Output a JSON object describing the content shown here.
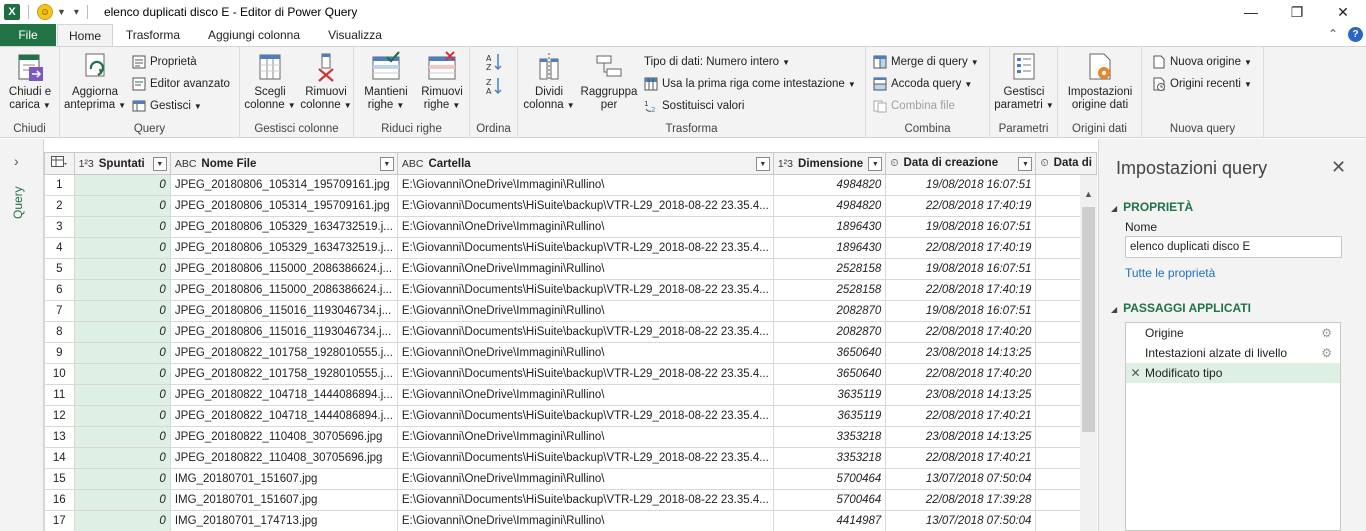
{
  "titlebar": {
    "app_badge": "X",
    "title": "elenco duplicati disco E - Editor di Power Query",
    "minimize": "—",
    "restore": "❐",
    "close": "✕"
  },
  "tabs": {
    "file": "File",
    "items": [
      "Home",
      "Trasforma",
      "Aggiungi colonna",
      "Visualizza"
    ],
    "active": "Home",
    "collapse": "⌃",
    "help": "?"
  },
  "ribbon": {
    "chiudi": {
      "label": "Chiudi",
      "btn1": "Chiudi e",
      "btn2": "carica"
    },
    "query": {
      "label": "Query",
      "refresh1": "Aggiorna",
      "refresh2": "anteprima",
      "properties": "Proprietà",
      "advanced_editor": "Editor avanzato",
      "manage": "Gestisci"
    },
    "manage_columns": {
      "label": "Gestisci colonne",
      "choose1": "Scegli",
      "choose2": "colonne",
      "remove1": "Rimuovi",
      "remove2": "colonne"
    },
    "reduce_rows": {
      "label": "Riduci righe",
      "keep1": "Mantieni",
      "keep2": "righe",
      "remove1": "Rimuovi",
      "remove2": "righe"
    },
    "sort": {
      "label": "Ordina"
    },
    "transform": {
      "label": "Trasforma",
      "split1": "Dividi",
      "split2": "colonna",
      "group1": "Raggruppa",
      "group2": "per",
      "data_type": "Tipo di dati: Numero intero",
      "first_row": "Usa la prima riga come intestazione",
      "replace": "Sostituisci valori"
    },
    "combine": {
      "label": "Combina",
      "merge": "Merge di query",
      "append": "Accoda query",
      "combine_files": "Combina file"
    },
    "params": {
      "label": "Parametri",
      "manage1": "Gestisci",
      "manage2": "parametri"
    },
    "data_sources": {
      "label": "Origini dati",
      "settings1": "Impostazioni",
      "settings2": "origine dati"
    },
    "new_query": {
      "label": "Nuova query",
      "new_source": "Nuova origine",
      "recent": "Origini recenti"
    }
  },
  "query_pane": {
    "label": "Query",
    "chevron": "›"
  },
  "grid": {
    "columns": [
      {
        "type": "1²3",
        "name": "Spuntati"
      },
      {
        "type": "ABC",
        "name": "Nome File"
      },
      {
        "type": "ABC",
        "name": "Cartella"
      },
      {
        "type": "1²3",
        "name": "Dimensione"
      },
      {
        "type": "⏲",
        "name": "Data di creazione"
      },
      {
        "type": "⏲",
        "name": "Data di"
      }
    ],
    "rows": [
      [
        "1",
        "0",
        "JPEG_20180806_105314_195709161.jpg",
        "E:\\Giovanni\\OneDrive\\Immagini\\Rullino\\",
        "4984820",
        "19/08/2018 16:07:51"
      ],
      [
        "2",
        "0",
        "JPEG_20180806_105314_195709161.jpg",
        "E:\\Giovanni\\Documents\\HiSuite\\backup\\VTR-L29_2018-08-22 23.35.4...",
        "4984820",
        "22/08/2018 17:40:19"
      ],
      [
        "3",
        "0",
        "JPEG_20180806_105329_1634732519.j...",
        "E:\\Giovanni\\OneDrive\\Immagini\\Rullino\\",
        "1896430",
        "19/08/2018 16:07:51"
      ],
      [
        "4",
        "0",
        "JPEG_20180806_105329_1634732519.j...",
        "E:\\Giovanni\\Documents\\HiSuite\\backup\\VTR-L29_2018-08-22 23.35.4...",
        "1896430",
        "22/08/2018 17:40:19"
      ],
      [
        "5",
        "0",
        "JPEG_20180806_115000_2086386624.j...",
        "E:\\Giovanni\\OneDrive\\Immagini\\Rullino\\",
        "2528158",
        "19/08/2018 16:07:51"
      ],
      [
        "6",
        "0",
        "JPEG_20180806_115000_2086386624.j...",
        "E:\\Giovanni\\Documents\\HiSuite\\backup\\VTR-L29_2018-08-22 23.35.4...",
        "2528158",
        "22/08/2018 17:40:19"
      ],
      [
        "7",
        "0",
        "JPEG_20180806_115016_1193046734.j...",
        "E:\\Giovanni\\OneDrive\\Immagini\\Rullino\\",
        "2082870",
        "19/08/2018 16:07:51"
      ],
      [
        "8",
        "0",
        "JPEG_20180806_115016_1193046734.j...",
        "E:\\Giovanni\\Documents\\HiSuite\\backup\\VTR-L29_2018-08-22 23.35.4...",
        "2082870",
        "22/08/2018 17:40:20"
      ],
      [
        "9",
        "0",
        "JPEG_20180822_101758_1928010555.j...",
        "E:\\Giovanni\\OneDrive\\Immagini\\Rullino\\",
        "3650640",
        "23/08/2018 14:13:25"
      ],
      [
        "10",
        "0",
        "JPEG_20180822_101758_1928010555.j...",
        "E:\\Giovanni\\Documents\\HiSuite\\backup\\VTR-L29_2018-08-22 23.35.4...",
        "3650640",
        "22/08/2018 17:40:20"
      ],
      [
        "11",
        "0",
        "JPEG_20180822_104718_1444086894.j...",
        "E:\\Giovanni\\OneDrive\\Immagini\\Rullino\\",
        "3635119",
        "23/08/2018 14:13:25"
      ],
      [
        "12",
        "0",
        "JPEG_20180822_104718_1444086894.j...",
        "E:\\Giovanni\\Documents\\HiSuite\\backup\\VTR-L29_2018-08-22 23.35.4...",
        "3635119",
        "22/08/2018 17:40:21"
      ],
      [
        "13",
        "0",
        "JPEG_20180822_110408_30705696.jpg",
        "E:\\Giovanni\\OneDrive\\Immagini\\Rullino\\",
        "3353218",
        "23/08/2018 14:13:25"
      ],
      [
        "14",
        "0",
        "JPEG_20180822_110408_30705696.jpg",
        "E:\\Giovanni\\Documents\\HiSuite\\backup\\VTR-L29_2018-08-22 23.35.4...",
        "3353218",
        "22/08/2018 17:40:21"
      ],
      [
        "15",
        "0",
        "IMG_20180701_151607.jpg",
        "E:\\Giovanni\\OneDrive\\Immagini\\Rullino\\",
        "5700464",
        "13/07/2018 07:50:04"
      ],
      [
        "16",
        "0",
        "IMG_20180701_151607.jpg",
        "E:\\Giovanni\\Documents\\HiSuite\\backup\\VTR-L29_2018-08-22 23.35.4...",
        "5700464",
        "22/08/2018 17:39:28"
      ],
      [
        "17",
        "0",
        "IMG_20180701_174713.jpg",
        "E:\\Giovanni\\OneDrive\\Immagini\\Rullino\\",
        "4414987",
        "13/07/2018 07:50:04"
      ]
    ]
  },
  "settings": {
    "title": "Impostazioni query",
    "close": "✕",
    "properties_header": "PROPRIETÀ",
    "name_label": "Nome",
    "name_value": "elenco duplicati disco E",
    "all_properties": "Tutte le proprietà",
    "steps_header": "PASSAGGI APPLICATI",
    "steps": [
      "Origine",
      "Intestazioni alzate di livello",
      "Modificato tipo"
    ],
    "step_gear": "⚙",
    "step_delete": "✕"
  },
  "colors": {
    "accent": "#217346",
    "selected_bg": "#def0e4"
  }
}
